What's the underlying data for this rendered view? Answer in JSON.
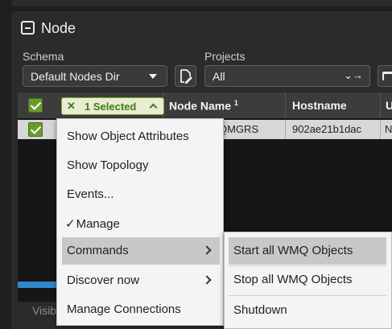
{
  "panel": {
    "title": "Node"
  },
  "filters": {
    "schema_label": "Schema",
    "schema_value": "Default Nodes Dir",
    "projects_label": "Projects",
    "projects_value": "All",
    "projects_arrows": "⌄→"
  },
  "grid": {
    "selection_label": "1 Selected",
    "selection_clear": "✕",
    "columns": [
      {
        "label": "Node Name",
        "sort_index": "1"
      },
      {
        "label": "Hostname"
      },
      {
        "label": "U"
      }
    ],
    "rows": [
      {
        "node_name": "QMGRS",
        "hostname": "902ae21b1dac",
        "extra": "N"
      }
    ],
    "footer_text": "Visib"
  },
  "context_menu": {
    "items": [
      {
        "label": "Show Object Attributes"
      },
      {
        "label": "Show Topology"
      },
      {
        "label": "Events..."
      },
      {
        "label": "Manage",
        "checked": true,
        "check_glyph": "✓"
      },
      {
        "label": "Commands",
        "has_submenu": true,
        "highlighted": true
      },
      {
        "label": "Discover now",
        "has_submenu": true
      },
      {
        "label": "Manage Connections"
      }
    ]
  },
  "submenu": {
    "items": [
      {
        "label": "Start all WMQ Objects",
        "highlighted": true
      },
      {
        "label": "Stop all WMQ Objects"
      },
      {
        "label": "Shutdown"
      }
    ]
  },
  "colors": {
    "accent_green": "#6a9a2e",
    "selection_text": "#3f7d16",
    "progress_blue": "#2f88c8",
    "menu_highlight": "#c8c8c8"
  }
}
